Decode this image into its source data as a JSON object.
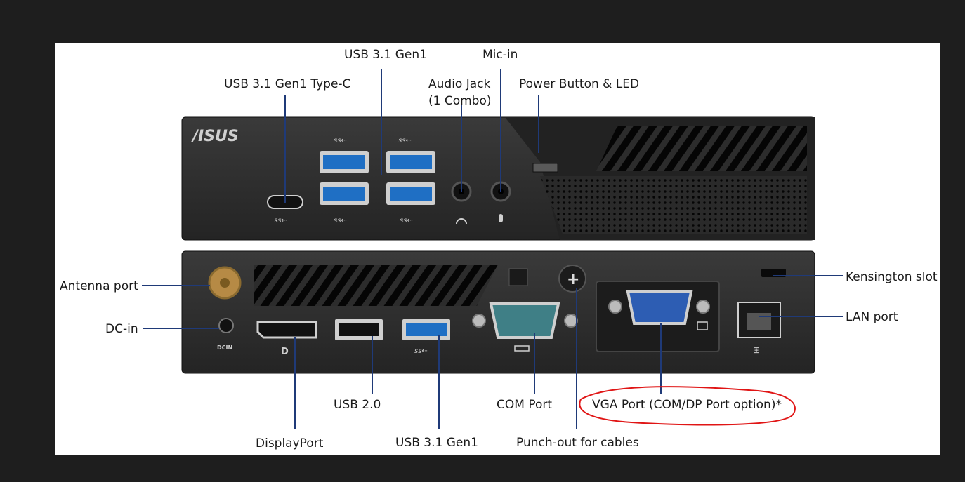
{
  "front_labels": {
    "usb_typec": "USB 3.1 Gen1 Type-C",
    "usb_gen1_front": "USB 3.1 Gen1",
    "audio_jack_line1": "Audio Jack",
    "audio_jack_line2": "(1 Combo)",
    "mic_in": "Mic-in",
    "power_button": "Power Button & LED"
  },
  "rear_labels": {
    "antenna": "Antenna port",
    "dc_in": "DC-in",
    "kensington": "Kensington slot",
    "lan": "LAN port",
    "displayport": "DisplayPort",
    "usb2": "USB 2.0",
    "usb_gen1_rear": "USB 3.1 Gen1",
    "com_port": "COM Port",
    "punch_out": "Punch-out for cables",
    "vga_port": "VGA Port (COM/DP Port option)*"
  },
  "device_text": {
    "brand": "/ISUS",
    "usb_ss": "ss⇠",
    "dcin": "DCIN"
  },
  "colors": {
    "background": "#1e1e1e",
    "panel": "#ffffff",
    "leader_line": "#1f3a78",
    "device_body": "#2a2a2a",
    "usb3_blue": "#1f6fc4",
    "vga_blue": "#2d5db3",
    "annotation_red": "#e01515"
  }
}
